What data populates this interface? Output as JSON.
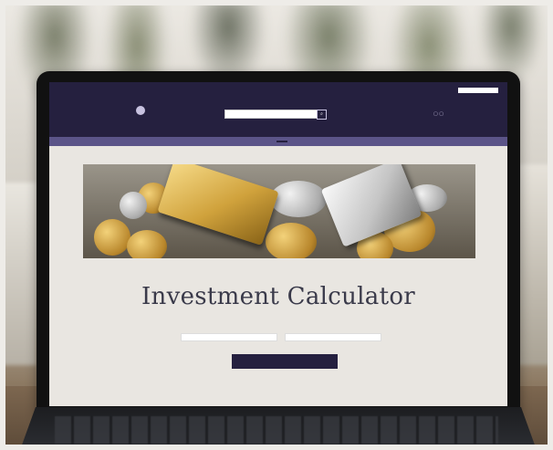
{
  "site": {
    "topbar_items": [
      "",
      "",
      ""
    ],
    "nav_items": [
      "",
      "",
      "",
      "",
      ""
    ],
    "promo_text": "",
    "promo_button": "",
    "breadcrumb": ""
  },
  "calculator": {
    "title": "Investment Calculator",
    "field1_label": "",
    "field1_value": "",
    "field2_label": "",
    "field2_value": "",
    "button_label": ""
  }
}
